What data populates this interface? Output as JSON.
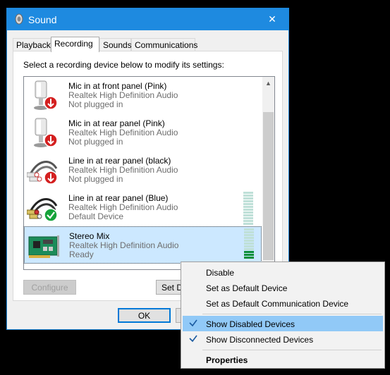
{
  "window": {
    "title": "Sound",
    "close_glyph": "✕"
  },
  "tabs": [
    {
      "label": "Playback"
    },
    {
      "label": "Recording"
    },
    {
      "label": "Sounds"
    },
    {
      "label": "Communications"
    }
  ],
  "instruction": "Select a recording device below to modify its settings:",
  "devices": [
    {
      "name": "Mic in at front panel (Pink)",
      "driver": "Realtek High Definition Audio",
      "status": "Not plugged in",
      "icon": "microphone-icon",
      "badge": "unplugged-arrow-icon"
    },
    {
      "name": "Mic in at rear panel (Pink)",
      "driver": "Realtek High Definition Audio",
      "status": "Not plugged in",
      "icon": "microphone-icon",
      "badge": "unplugged-arrow-icon"
    },
    {
      "name": "Line in at rear panel (black)",
      "driver": "Realtek High Definition Audio",
      "status": "Not plugged in",
      "icon": "rca-cable-icon",
      "badge": "unplugged-arrow-icon"
    },
    {
      "name": "Line in at rear panel (Blue)",
      "driver": "Realtek High Definition Audio",
      "status": "Default Device",
      "icon": "rca-cable-icon",
      "badge": "default-check-icon"
    },
    {
      "name": "Stereo Mix",
      "driver": "Realtek High Definition Audio",
      "status": "Ready",
      "icon": "sound-card-icon",
      "badge": ""
    }
  ],
  "buttons": {
    "configure": "Configure",
    "set_default": "Set De",
    "ok": "OK"
  },
  "context_menu": {
    "items": [
      {
        "label": "Disable",
        "checked": false
      },
      {
        "label": "Set as Default Device",
        "checked": false
      },
      {
        "label": "Set as Default Communication Device",
        "checked": false
      },
      {
        "label": "Show Disabled Devices",
        "checked": true
      },
      {
        "label": "Show Disconnected Devices",
        "checked": true
      },
      {
        "label": "Properties",
        "checked": false
      }
    ]
  },
  "colors": {
    "titlebar": "#1e8ae0",
    "selection": "#cce8ff",
    "menu_highlight": "#91c9f7",
    "meter_on": "#0e8f3a",
    "unplugged_badge": "#d42020",
    "default_badge": "#16a33a"
  }
}
